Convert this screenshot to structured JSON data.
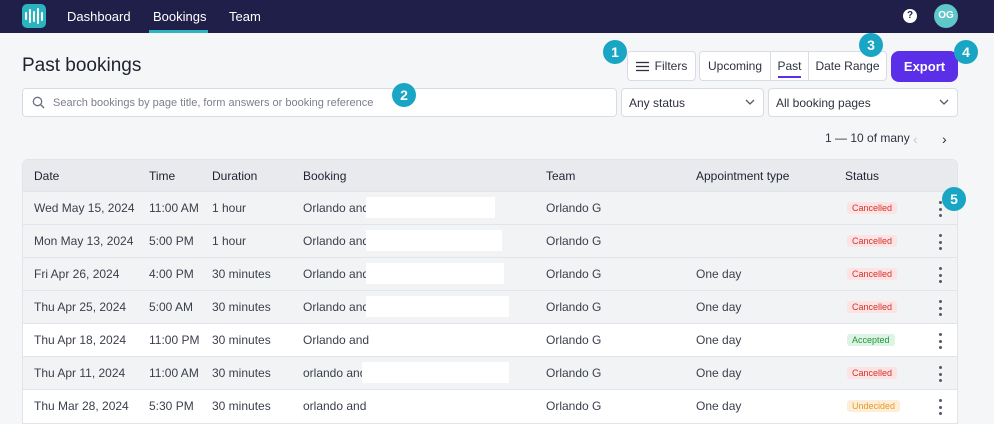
{
  "nav": {
    "items": [
      "Dashboard",
      "Bookings",
      "Team"
    ],
    "active": "Bookings",
    "help_icon": "?",
    "avatar_initials": "OG"
  },
  "page": {
    "title": "Past bookings"
  },
  "toolbar": {
    "filters_label": "Filters",
    "segments": [
      "Upcoming",
      "Past",
      "Date Range"
    ],
    "active_segment": "Past",
    "export_label": "Export",
    "accent_color": "#5b2ee8"
  },
  "search": {
    "placeholder": "Search bookings by page title, form answers or booking reference",
    "value": ""
  },
  "status_filter": {
    "value": "Any status"
  },
  "pages_filter": {
    "value": "All booking pages"
  },
  "pagination": {
    "text": "1 — 10 of many"
  },
  "table": {
    "columns": [
      "Date",
      "Time",
      "Duration",
      "Booking",
      "Team",
      "Appointment type",
      "Status"
    ],
    "rows": [
      {
        "date": "Wed May 15, 2024",
        "time": "11:00 AM",
        "duration": "1 hour",
        "booking": "Orlando and",
        "team": "Orlando G",
        "appointment_type": "",
        "status": "Cancelled"
      },
      {
        "date": "Mon May 13, 2024",
        "time": "5:00 PM",
        "duration": "1 hour",
        "booking": "Orlando and",
        "team": "Orlando G",
        "appointment_type": "",
        "status": "Cancelled"
      },
      {
        "date": "Fri Apr 26, 2024",
        "time": "4:00 PM",
        "duration": "30 minutes",
        "booking": "Orlando and",
        "team": "Orlando G",
        "appointment_type": "One day",
        "status": "Cancelled"
      },
      {
        "date": "Thu Apr 25, 2024",
        "time": "5:00 AM",
        "duration": "30 minutes",
        "booking": "Orlando and",
        "team": "Orlando G",
        "appointment_type": "One day",
        "status": "Cancelled"
      },
      {
        "date": "Thu Apr 18, 2024",
        "time": "11:00 PM",
        "duration": "30 minutes",
        "booking": "Orlando and",
        "team": "Orlando G",
        "appointment_type": "One day",
        "status": "Accepted"
      },
      {
        "date": "Thu Apr 11, 2024",
        "time": "11:00 AM",
        "duration": "30 minutes",
        "booking": "orlando and",
        "team": "Orlando G",
        "appointment_type": "One day",
        "status": "Cancelled"
      },
      {
        "date": "Thu Mar 28, 2024",
        "time": "5:30 PM",
        "duration": "30 minutes",
        "booking": "orlando and",
        "team": "Orlando G",
        "appointment_type": "One day",
        "status": "Undecided"
      }
    ]
  },
  "markers": [
    "1",
    "2",
    "3",
    "4",
    "5"
  ]
}
